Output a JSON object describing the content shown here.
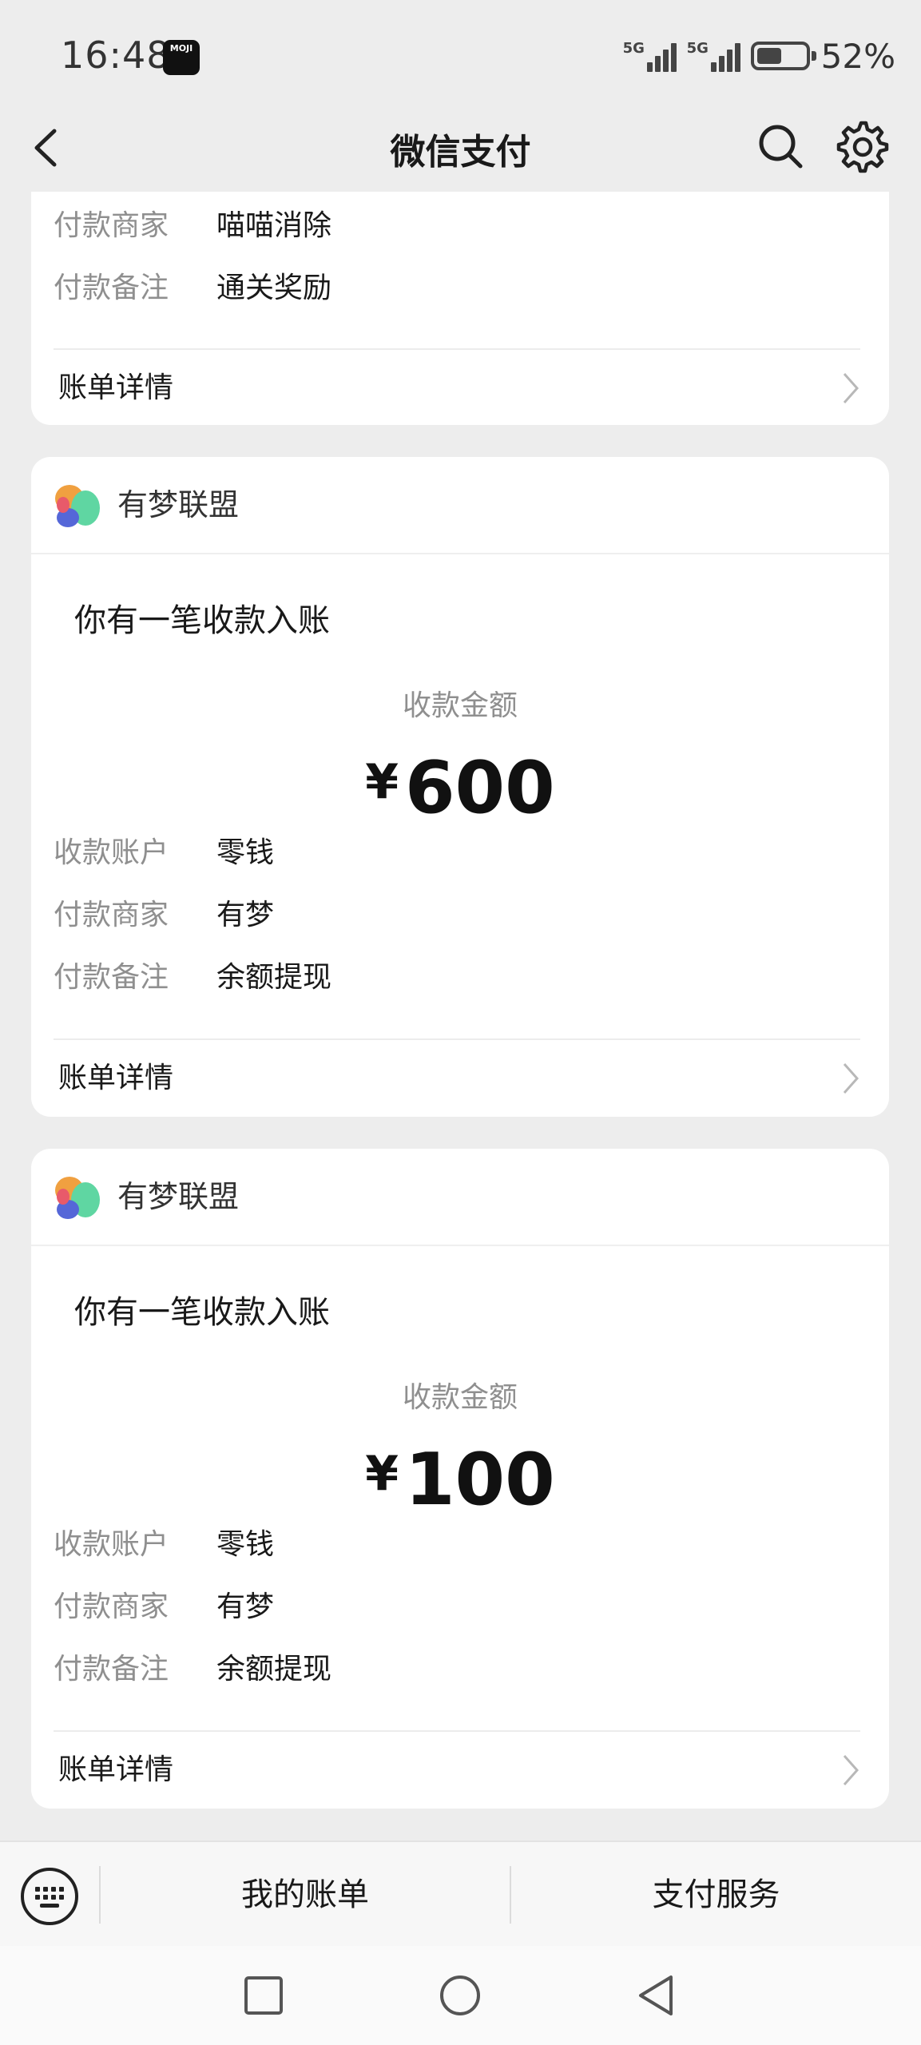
{
  "status_bar": {
    "time": "16:48",
    "app_badge": "MOJI",
    "signal_1": "5G",
    "signal_2": "5G",
    "battery_percent": "52%",
    "battery_level": 0.52
  },
  "nav": {
    "title": "微信支付",
    "back_icon": "chevron-left-icon",
    "search_icon": "search-icon",
    "settings_icon": "gear-icon"
  },
  "messages": [
    {
      "rows": [
        {
          "key": "付款商家",
          "value": "喵喵消除"
        },
        {
          "key": "付款备注",
          "value": "通关奖励"
        }
      ],
      "detail_label": "账单详情"
    },
    {
      "merchant": "有梦联盟",
      "notice": "你有一笔收款入账",
      "amount_label": "收款金额",
      "currency": "¥",
      "amount": "600",
      "rows": [
        {
          "key": "收款账户",
          "value": "零钱"
        },
        {
          "key": "付款商家",
          "value": "有梦"
        },
        {
          "key": "付款备注",
          "value": "余额提现"
        }
      ],
      "detail_label": "账单详情"
    },
    {
      "merchant": "有梦联盟",
      "notice": "你有一笔收款入账",
      "amount_label": "收款金额",
      "currency": "¥",
      "amount": "100",
      "rows": [
        {
          "key": "收款账户",
          "value": "零钱"
        },
        {
          "key": "付款商家",
          "value": "有梦"
        },
        {
          "key": "付款备注",
          "value": "余额提现"
        }
      ],
      "detail_label": "账单详情"
    }
  ],
  "bottom_bar": {
    "keyboard_icon": "keyboard-icon",
    "tab_bills": "我的账单",
    "tab_services": "支付服务"
  },
  "colors": {
    "background": "#ededed",
    "card": "#ffffff",
    "secondary_text": "#8f8f8f"
  }
}
